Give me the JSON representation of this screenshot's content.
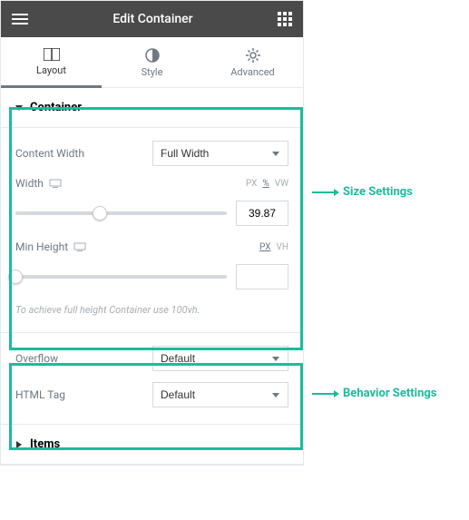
{
  "header": {
    "title": "Edit Container"
  },
  "tabs": {
    "layout": "Layout",
    "style": "Style",
    "advanced": "Advanced"
  },
  "container": {
    "title": "Container",
    "contentWidth": {
      "label": "Content Width",
      "value": "Full Width"
    },
    "width": {
      "label": "Width",
      "value": "39.87",
      "units": [
        "PX",
        "%",
        "VW"
      ],
      "activeUnit": "%"
    },
    "minHeight": {
      "label": "Min Height",
      "value": "",
      "units": [
        "PX",
        "VH"
      ],
      "activeUnit": "PX"
    },
    "hint": "To achieve full height Container use 100vh."
  },
  "behavior": {
    "overflow": {
      "label": "Overflow",
      "value": "Default"
    },
    "htmlTag": {
      "label": "HTML Tag",
      "value": "Default"
    }
  },
  "items": {
    "title": "Items"
  },
  "annotations": {
    "size": "Size Settings",
    "behavior": "Behavior Settings"
  }
}
